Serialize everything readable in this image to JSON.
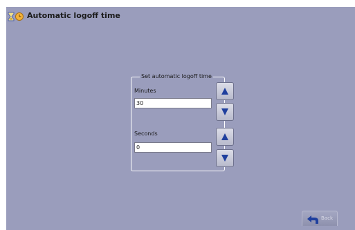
{
  "window": {
    "title": "Automatic logoff time",
    "icon": "hourglass-icon"
  },
  "panel": {
    "legend": "Set automatic logoff time",
    "minutes": {
      "label": "Minutes",
      "value": "30",
      "up_icon": "arrow-up-icon",
      "down_icon": "arrow-down-icon"
    },
    "seconds": {
      "label": "Seconds",
      "value": "0",
      "up_icon": "arrow-up-icon",
      "down_icon": "arrow-down-icon"
    }
  },
  "footer": {
    "back_label": "Back",
    "back_icon": "back-arrow-icon"
  },
  "colors": {
    "background": "#9a9dbc",
    "arrow": "#1f3f9e",
    "text": "#1a1a1a"
  }
}
